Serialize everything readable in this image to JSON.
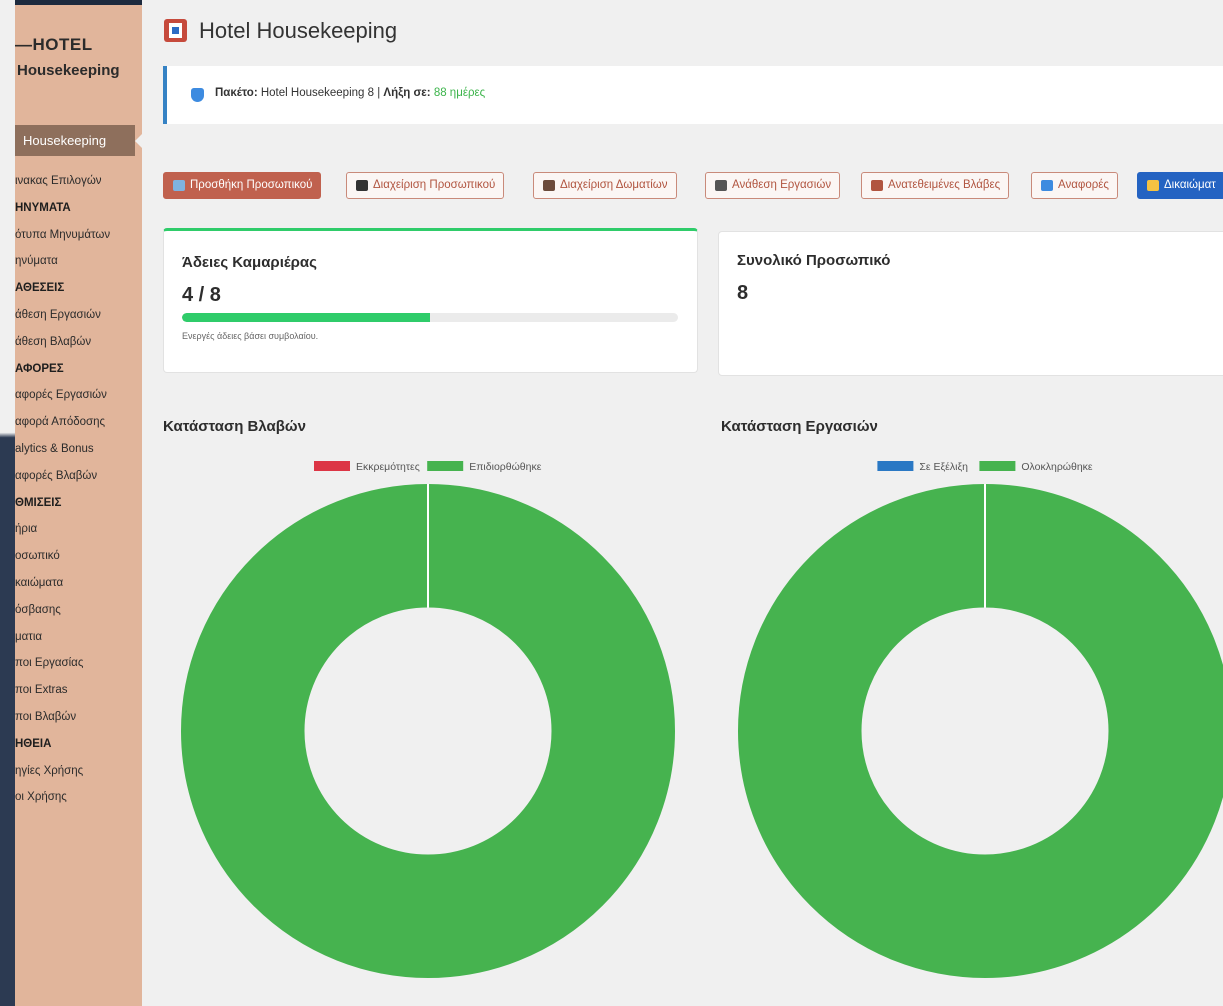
{
  "sidebar": {
    "logo_line1": "—HOTEL",
    "logo_line2": "Housekeeping",
    "active_item": "Housekeeping",
    "items": [
      {
        "label": "ινακας Επιλογών",
        "head": false
      },
      {
        "label": "ΗΝΥΜΑΤΑ",
        "head": true
      },
      {
        "label": "ότυπα Μηνυμάτων",
        "head": false
      },
      {
        "label": "ηνύματα",
        "head": false
      },
      {
        "label": "ΑΘΕΣΕΙΣ",
        "head": true
      },
      {
        "label": "άθεση Εργασιών",
        "head": false
      },
      {
        "label": "άθεση Βλαβών",
        "head": false
      },
      {
        "label": "ΑΦΟΡΕΣ",
        "head": true
      },
      {
        "label": "αφορές Εργασιών",
        "head": false
      },
      {
        "label": "αφορά Απόδοσης",
        "head": false
      },
      {
        "label": "alytics & Bonus",
        "head": false
      },
      {
        "label": "αφορές Βλαβών",
        "head": false
      },
      {
        "label": "ΘΜΙΣΕΙΣ",
        "head": true
      },
      {
        "label": "ήρια",
        "head": false
      },
      {
        "label": "οσωπικό",
        "head": false
      },
      {
        "label": "καιώματα",
        "head": false
      },
      {
        "label": "όσβασης",
        "head": false
      },
      {
        "label": "ματια",
        "head": false
      },
      {
        "label": "ποι Εργασίας",
        "head": false
      },
      {
        "label": "ποι Extras",
        "head": false
      },
      {
        "label": "ποι Βλαβών",
        "head": false
      },
      {
        "label": "ΗΘΕΙΑ",
        "head": true
      },
      {
        "label": "ηγίες Χρήσης",
        "head": false
      },
      {
        "label": "οι Χρήσης",
        "head": false
      }
    ]
  },
  "header": {
    "title": "Hotel Housekeeping",
    "icon": "hotel-icon"
  },
  "notice": {
    "icon": "shield-icon",
    "package_label": "Πακέτο:",
    "package_value": "Hotel Housekeeping 8 |",
    "expiry_label": "Λήξη σε:",
    "expiry_value": "88 ημέρες"
  },
  "actions": [
    {
      "label": "Προσθήκη Προσωπικού",
      "icon": "plus-icon",
      "icon_color": "#7fb3e0"
    },
    {
      "label": "Διαχείριση Προσωπικού",
      "icon": "users-icon",
      "icon_color": "#333333"
    },
    {
      "label": "Διαχείριση Δωματίων",
      "icon": "house-icon",
      "icon_color": "#6b4b3b"
    },
    {
      "label": "Ανάθεση Εργασιών",
      "icon": "clipboard-icon",
      "icon_color": "#555555"
    },
    {
      "label": "Ανατεθειμένες Βλάβες",
      "icon": "tools-icon",
      "icon_color": "#b15540"
    },
    {
      "label": "Αναφορές",
      "icon": "report-icon",
      "icon_color": "#3d8be0"
    },
    {
      "label": "Δικαιώματ",
      "icon": "key-icon",
      "icon_color": "#f5c242"
    }
  ],
  "cards": {
    "permits": {
      "title": "Άδειες Καμαριέρας",
      "value": "4 / 8",
      "progress": 0.5,
      "note": "Ενεργές άδειες βάσει συμβολαίου.",
      "accent": "#2fcc6a"
    },
    "staff": {
      "title": "Συνολικό Προσωπικό",
      "value": "8"
    }
  },
  "colors": {
    "sidebar": "#e1b59b",
    "primary_button": "#c0614e",
    "rights_button": "#2463c2",
    "red": "#dc3545",
    "green": "#46b34f",
    "blue": "#2a78c4"
  },
  "chart_data": [
    {
      "type": "pie",
      "title": "Κατάσταση Βλαβών",
      "donut": true,
      "legend_position": "top",
      "categories": [
        "Εκκρεμότητες",
        "Επιδιορθώθηκε"
      ],
      "values": [
        0,
        1
      ],
      "colors": [
        "#dc3545",
        "#46b34f"
      ]
    },
    {
      "type": "pie",
      "title": "Κατάσταση Εργασιών",
      "donut": true,
      "legend_position": "top",
      "categories": [
        "Σε Εξέλιξη",
        "Ολοκληρώθηκε"
      ],
      "values": [
        0,
        1
      ],
      "colors": [
        "#2a78c4",
        "#46b34f"
      ]
    }
  ]
}
